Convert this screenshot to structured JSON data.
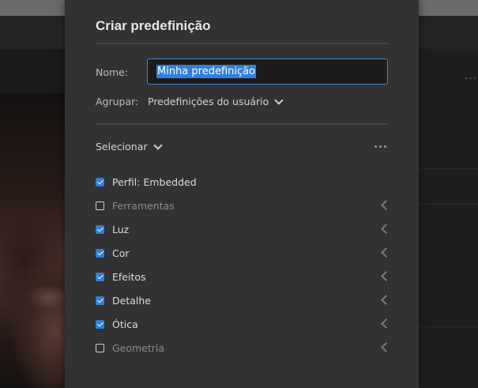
{
  "dialog": {
    "title": "Criar predefinição",
    "name_label": "Nome:",
    "name_value": "Minha predefinição",
    "group_label": "Agrupar:",
    "group_value": "Predefinições do usuário",
    "select_label": "Selecionar"
  },
  "settings": [
    {
      "label": "Perfil: Embedded",
      "checked": true,
      "expandable": false
    },
    {
      "label": "Ferramentas",
      "checked": false,
      "expandable": true
    },
    {
      "label": "Luz",
      "checked": true,
      "expandable": true
    },
    {
      "label": "Cor",
      "checked": true,
      "expandable": true
    },
    {
      "label": "Efeitos",
      "checked": true,
      "expandable": true
    },
    {
      "label": "Detalhe",
      "checked": true,
      "expandable": true
    },
    {
      "label": "Ótica",
      "checked": true,
      "expandable": true
    },
    {
      "label": "Geometria",
      "checked": false,
      "expandable": true
    }
  ],
  "colors": {
    "accent": "#2f7fdb",
    "dialog_bg": "#323232"
  },
  "icons": {
    "more": "more-dots-icon",
    "dropdown": "chevron-down-icon",
    "expand": "chevron-left-icon",
    "check": "checkmark-icon"
  }
}
